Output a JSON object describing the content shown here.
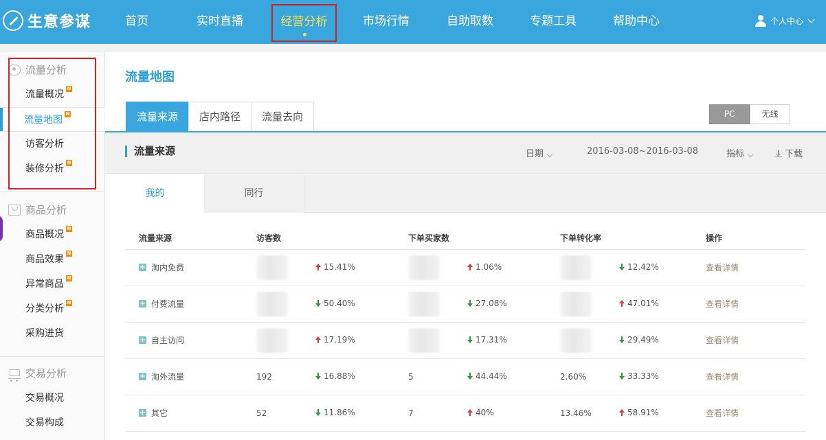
{
  "app": {
    "logo_text": "生意参谋"
  },
  "nav": {
    "items": [
      {
        "label": "首页"
      },
      {
        "label": "实时直播"
      },
      {
        "label": "经营分析"
      },
      {
        "label": "市场行情"
      },
      {
        "label": "自助取数"
      },
      {
        "label": "专题工具"
      },
      {
        "label": "帮助中心"
      }
    ],
    "user_label": "个人中心"
  },
  "sidebar": {
    "groups": [
      {
        "title": "流量分析",
        "icon": "eye-icon",
        "items": [
          {
            "label": "流量概况",
            "badge": "N"
          },
          {
            "label": "流量地图",
            "badge": "N"
          },
          {
            "label": "访客分析",
            "badge": ""
          },
          {
            "label": "装修分析",
            "badge": "N"
          }
        ]
      },
      {
        "title": "商品分析",
        "icon": "bag-icon",
        "items": [
          {
            "label": "商品概况",
            "badge": "N"
          },
          {
            "label": "商品效果",
            "badge": "N"
          },
          {
            "label": "异常商品",
            "badge": "N"
          },
          {
            "label": "分类分析",
            "badge": "N"
          },
          {
            "label": "采购进货",
            "badge": ""
          }
        ]
      },
      {
        "title": "交易分析",
        "icon": "cart-icon",
        "items": [
          {
            "label": "交易概况",
            "badge": ""
          },
          {
            "label": "交易构成",
            "badge": ""
          }
        ]
      }
    ]
  },
  "main": {
    "page_title": "流量地图",
    "tabs": [
      {
        "label": "流量来源"
      },
      {
        "label": "店内路径"
      },
      {
        "label": "流量去向"
      }
    ],
    "device": {
      "pc": "PC",
      "wireless": "无线"
    },
    "section": {
      "title": "流量来源",
      "date_label": "日期",
      "date_range": "2016-03-08~2016-03-08",
      "metric_label": "指标",
      "download_label": "下载"
    },
    "subtabs": {
      "mine": "我的",
      "peer": "同行"
    },
    "table": {
      "headers": [
        "流量来源",
        "访客数",
        "下单买家数",
        "下单转化率",
        "操作"
      ],
      "rows": [
        {
          "source": "淘内免费",
          "visitors": "",
          "visitors_change": "15.41%",
          "visitors_dir": "up",
          "buyers": "",
          "buyers_change": "1.06%",
          "buyers_dir": "up",
          "rate": "",
          "rate_change": "12.42%",
          "rate_dir": "down",
          "action": "查看详情"
        },
        {
          "source": "付费流量",
          "visitors": "",
          "visitors_change": "50.40%",
          "visitors_dir": "down",
          "buyers": "",
          "buyers_change": "27.08%",
          "buyers_dir": "down",
          "rate": "",
          "rate_change": "47.01%",
          "rate_dir": "up",
          "action": "查看详情"
        },
        {
          "source": "自主访问",
          "visitors": "",
          "visitors_change": "17.19%",
          "visitors_dir": "up",
          "buyers": "",
          "buyers_change": "17.31%",
          "buyers_dir": "down",
          "rate": "",
          "rate_change": "29.49%",
          "rate_dir": "down",
          "action": "查看详情"
        },
        {
          "source": "淘外流量",
          "visitors": "192",
          "visitors_change": "16.88%",
          "visitors_dir": "down",
          "buyers": "5",
          "buyers_change": "44.44%",
          "buyers_dir": "down",
          "rate": "2.60%",
          "rate_change": "33.33%",
          "rate_dir": "down",
          "action": "查看详情"
        },
        {
          "source": "其它",
          "visitors": "52",
          "visitors_change": "11.86%",
          "visitors_dir": "down",
          "buyers": "7",
          "buyers_change": "40%",
          "buyers_dir": "up",
          "rate": "13.46%",
          "rate_change": "58.91%",
          "rate_dir": "up",
          "action": "查看详情"
        }
      ]
    }
  },
  "colors": {
    "brand": "#3aa6de",
    "active_nav": "#ffe04c",
    "up": "#e0393e",
    "down": "#2a9a3a",
    "badge": "#ff8a00"
  }
}
